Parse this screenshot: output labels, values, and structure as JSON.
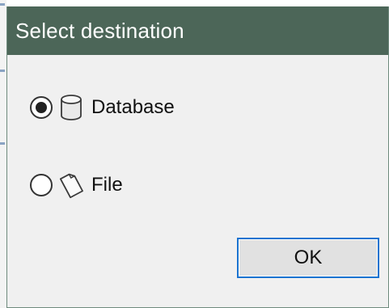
{
  "dialog": {
    "title": "Select destination",
    "options": [
      {
        "label": "Database",
        "selected": true,
        "icon": "database-icon"
      },
      {
        "label": "File",
        "selected": false,
        "icon": "file-icon"
      }
    ],
    "ok_label": "OK"
  },
  "colors": {
    "title_bar": "#4c6658",
    "title_text": "#ffffff",
    "dialog_bg": "#f0f0f0",
    "button_focus_border": "#1a73d0"
  }
}
